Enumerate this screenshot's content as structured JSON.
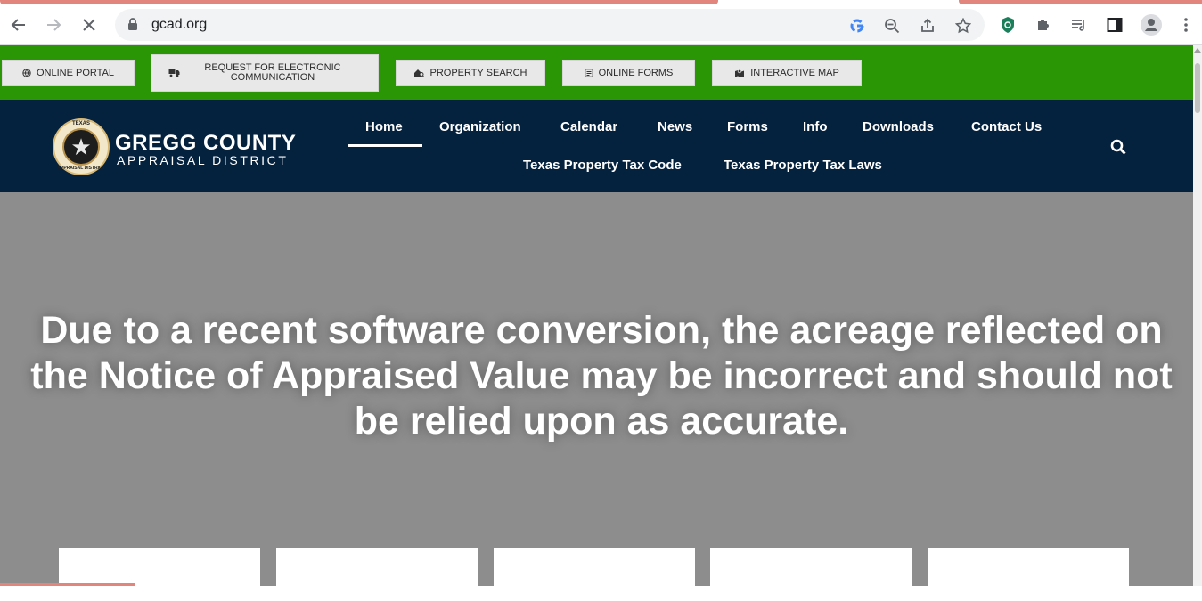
{
  "browser": {
    "url": "gcad.org",
    "icons": [
      "back-arrow-icon",
      "forward-arrow-icon",
      "stop-loading-icon",
      "lock-icon",
      "google-icon",
      "zoom-out-icon",
      "share-icon",
      "bookmark-star-icon",
      "shield-extension-icon",
      "extensions-puzzle-icon",
      "reading-list-icon",
      "side-panel-icon",
      "profile-icon",
      "menu-dots-icon"
    ]
  },
  "topbar": {
    "buttons": [
      {
        "label": "ONLINE PORTAL",
        "icon": "globe-icon"
      },
      {
        "label": "REQUEST FOR ELECTRONIC COMMUNICATION",
        "icon": "mail-truck-icon"
      },
      {
        "label": "PROPERTY SEARCH",
        "icon": "house-search-icon"
      },
      {
        "label": "ONLINE FORMS",
        "icon": "form-icon"
      },
      {
        "label": "INTERACTIVE MAP",
        "icon": "map-icon"
      }
    ]
  },
  "logo": {
    "title": "GREGG COUNTY",
    "subtitle": "APPRAISAL DISTRICT",
    "seal_top": "TEXAS",
    "seal_bottom": "APPRAISAL DISTRICT"
  },
  "nav": {
    "items": [
      {
        "label": "Home",
        "active": true
      },
      {
        "label": "Organization"
      },
      {
        "label": "Calendar"
      },
      {
        "label": "News"
      },
      {
        "label": "Forms"
      },
      {
        "label": "Info"
      },
      {
        "label": "Downloads"
      },
      {
        "label": "Contact Us"
      },
      {
        "label": "Texas Property Tax Code"
      },
      {
        "label": "Texas Property Tax Laws"
      }
    ]
  },
  "hero": {
    "text": "Due to a recent software conversion, the acreage reflected on the Notice of Appraised Value may be incorrect and should not be relied upon as accurate."
  },
  "colors": {
    "topbar": "#2a9606",
    "nav": "#04213e",
    "hero": "#8d8d8d",
    "accent": "#e2857c"
  }
}
